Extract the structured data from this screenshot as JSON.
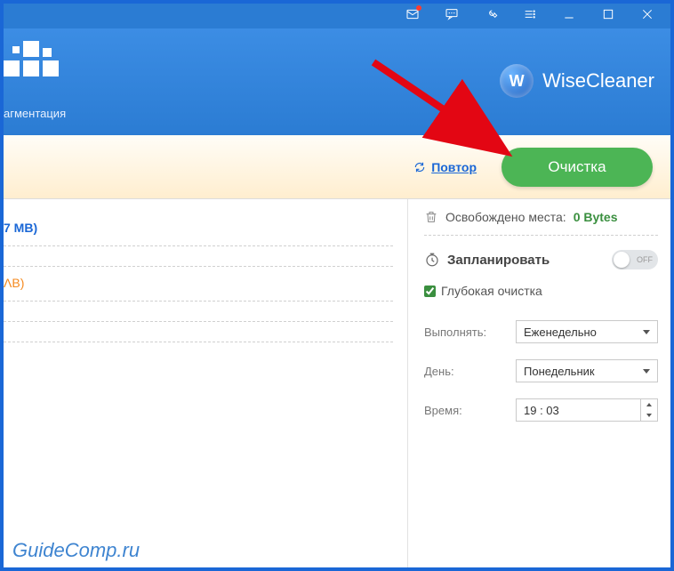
{
  "app": {
    "name": "WiseCleaner",
    "logo_letter": "W"
  },
  "header": {
    "tab_label": "агментация"
  },
  "actionbar": {
    "repeat_label": "Повтор",
    "clean_label": "Очистка"
  },
  "left": {
    "items": [
      {
        "text": "7 MB)",
        "style": "blue"
      },
      {
        "text": ""
      },
      {
        "text": "ΛΒ)",
        "style": "orange"
      },
      {
        "text": ""
      },
      {
        "text": ""
      }
    ]
  },
  "right": {
    "freed_label": "Освобождено места:",
    "freed_value": "0 Bytes",
    "schedule_title": "Запланировать",
    "toggle_state": "OFF",
    "deep_clean_label": "Глубокая очистка",
    "deep_clean_checked": true,
    "rows": {
      "frequency_label": "Выполнять:",
      "frequency_value": "Еженедельно",
      "day_label": "День:",
      "day_value": "Понедельник",
      "time_label": "Время:",
      "time_value": "19 : 03"
    }
  },
  "watermark": "GuideComp.ru",
  "colors": {
    "primary": "#2b7cd3",
    "accent_green": "#4cb555",
    "link": "#1a67d6"
  }
}
